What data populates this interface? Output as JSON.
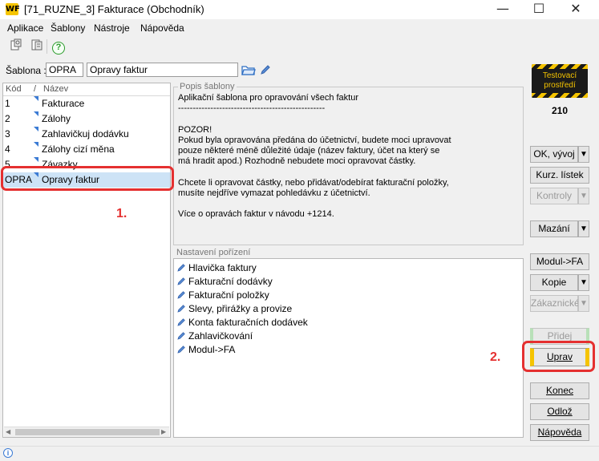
{
  "window": {
    "title": "[71_RUZNE_3] Fakturace (Obchodník)",
    "logo_text": "WF",
    "minimize": "—",
    "maximize": "☐",
    "close": "✕"
  },
  "menu": [
    "Aplikace",
    "Šablony",
    "Nástroje",
    "Nápověda"
  ],
  "sablona": {
    "label": "Šablona :",
    "code": "OPRA",
    "name": "Opravy faktur"
  },
  "list": {
    "headers": {
      "code": "Kód",
      "sort": "/",
      "name": "Název"
    },
    "rows": [
      {
        "code": "1",
        "name": "Fakturace"
      },
      {
        "code": "2",
        "name": "Zálohy"
      },
      {
        "code": "3",
        "name": "Zahlavičkuj dodávku"
      },
      {
        "code": "4",
        "name": "Zálohy cizí měna"
      },
      {
        "code": "5",
        "name": "Závazky"
      },
      {
        "code": "OPRA",
        "name": "Opravy faktur"
      }
    ]
  },
  "description": {
    "title": "Popis šablony",
    "text": "Aplikační šablona pro opravování všech faktur\n--------------------------------------------------\n\nPOZOR!\nPokud byla opravována předána do účetnictví, budete moci upravovat\npouze některé méně důležité údaje (název faktury, účet na který se\nmá hradit apod.) Rozhodně nebudete moci opravovat částky.\n\nChcete li opravovat částky, nebo přidávat/odebírat fakturační položky,\nmusíte nejdříve vymazat pohledávku z účetnictví.\n\nVíce o opravách faktur v návodu +1214."
  },
  "settings": {
    "title": "Nastavení pořízení",
    "items": [
      "Hlavička faktury",
      "Fakturační dodávky",
      "Fakturační položky",
      "Slevy, přirážky a provize",
      "Konta fakturačních dodávek",
      "Zahlavičkování",
      "Modul->FA"
    ]
  },
  "environment": {
    "badge": "Testovací prostředí",
    "number": "210"
  },
  "buttons": {
    "ok_vyvoj": "OK, vývoj",
    "kurz_listek": "Kurz. lístek",
    "kontroly": "Kontroly",
    "mazani": "Mazání",
    "modul_fa": "Modul->FA",
    "kopie": "Kopie",
    "zakaznicke": "Zákaznické",
    "pridej": "Přidej",
    "uprav": "Uprav",
    "konec": "Konec",
    "odloz": "Odlož",
    "napoveda": "Nápověda",
    "arrow": "▼"
  },
  "annotations": {
    "one": "1.",
    "two": "2."
  },
  "colors": {
    "annotation": "#e53030",
    "selection": "#cde3f6",
    "brand": "#f5c400"
  }
}
